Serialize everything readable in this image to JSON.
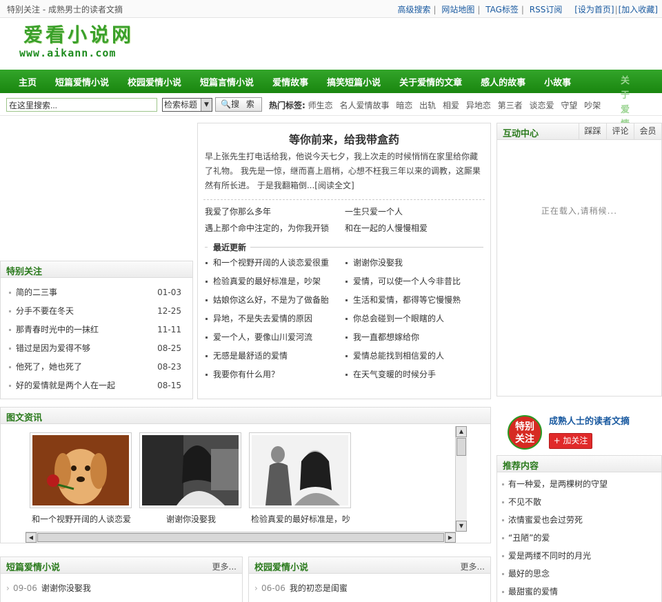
{
  "topbar": {
    "left_text": "特别关注 - 成熟男士的读者文摘",
    "links": [
      "高级搜索",
      "网站地图",
      "TAG标签",
      "RSS订阅"
    ],
    "set_home": "[设为首页]",
    "add_fav": "[加入收藏]"
  },
  "logo": {
    "cn": "爱看小说网",
    "en": "www.aikann.com"
  },
  "nav": {
    "items": [
      "主页",
      "短篇爱情小说",
      "校园爱情小说",
      "短篇言情小说",
      "爱情故事",
      "搞笑短篇小说",
      "关于爱情的文章",
      "感人的故事",
      "小故事"
    ],
    "overflow_label": "关于爱情的句子"
  },
  "search": {
    "placeholder": "在这里搜索...",
    "select_value": "检索标题",
    "button": "搜 索",
    "hot_label": "热门标签:",
    "hot_tags": [
      "师生恋",
      "名人爱情故事",
      "暗恋",
      "出轨",
      "相爱",
      "异地恋",
      "第三者",
      "谈恋爱",
      "守望",
      "吵架"
    ]
  },
  "special": {
    "title": "特别关注",
    "items": [
      {
        "title": "简的二三事",
        "date": "01-03"
      },
      {
        "title": "分手不要在冬天",
        "date": "12-25"
      },
      {
        "title": "那青春时光中的一抹红",
        "date": "11-11"
      },
      {
        "title": "错过是因为爱得不够",
        "date": "08-25"
      },
      {
        "title": "他死了，她也死了",
        "date": "08-23"
      },
      {
        "title": "好的爱情就是两个人在一起",
        "date": "08-15"
      }
    ]
  },
  "featured": {
    "title": "等你前来，给我带盒药",
    "intro": "早上张先生打电话给我，他说今天七夕，我上次走的时候悄悄在家里给你藏了礼物。 我先是一惊，继而喜上眉梢，心想不枉我三年以来的调教，这厮果然有所长进。 于是我翻箱倒...[阅读全文]",
    "links": [
      "我爱了你那么多年",
      "一生只爱一个人",
      "遇上那个命中注定的，为你我开锁",
      "和在一起的人慢慢相爱"
    ],
    "recent_title": "最近更新",
    "recent": [
      "和一个视野开阔的人谈恋爱很重",
      "谢谢你没娶我",
      "检验真爱的最好标准是，吵架",
      "爱情，可以使一个人今非昔比",
      "姑娘你这么好，不是为了做备胎",
      "生活和爱情，都得等它慢慢熟",
      "异地，不是失去爱情的原因",
      "你总会碰到一个眼瞎的人",
      "爱一个人，要像山川爱河流",
      "我一直都想嫁给你",
      "无感是最舒适的爱情",
      "爱情总能找到相信爱的人",
      "我要你有什么用？",
      "在天气变暖的时候分手"
    ]
  },
  "interact": {
    "title": "互动中心",
    "tabs": [
      "踩踩",
      "评论",
      "会员"
    ],
    "loading": "正在载入,请稍候..."
  },
  "follow": {
    "seal_text": "特别关注",
    "name": "成熟人士的读者文摘",
    "button": "+ 加关注"
  },
  "recommend": {
    "title": "推荐内容",
    "items": [
      "有一种爱，是两棵树的守望",
      "不见不散",
      "浓情蜜爱也会过劳死",
      "“丑陋”的爱",
      "爱是两缕不同时的月光",
      "最好的思念",
      "最甜蜜的爱情"
    ]
  },
  "picnews": {
    "title": "图文资讯",
    "items": [
      {
        "caption": "和一个视野开阔的人谈恋爱很重要",
        "icon": "puppy-rose-image"
      },
      {
        "caption": "谢谢你没娶我",
        "icon": "bride-image"
      },
      {
        "caption": "检验真爱的最好标准是，吵架",
        "icon": "couple-image"
      }
    ]
  },
  "col1": {
    "title": "短篇爱情小说",
    "more": "更多...",
    "items": [
      {
        "date": "09-06",
        "title": "谢谢你没娶我"
      }
    ]
  },
  "col2": {
    "title": "校园爱情小说",
    "more": "更多...",
    "items": [
      {
        "date": "06-06",
        "title": "我的初恋是闺蜜"
      }
    ]
  },
  "colors": {
    "brand_green": "#22951a",
    "link_blue": "#1a5aa0",
    "title_green": "#2a7a1c"
  }
}
